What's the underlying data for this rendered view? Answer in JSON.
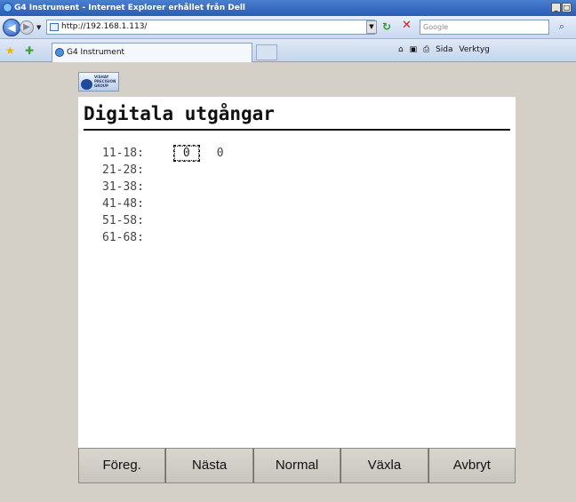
{
  "window": {
    "title": "G4 Instrument - Internet Explorer erhållet från Dell",
    "controls": [
      "_",
      "□",
      "x"
    ]
  },
  "address_bar": {
    "url": "http://192.168.1.113/",
    "search_placeholder": "Google"
  },
  "tabs": [
    {
      "label": "G4 Instrument",
      "active": true
    }
  ],
  "command_bar": {
    "home": "⌂",
    "feeds": "▣",
    "print": "⎙",
    "page_label": "Sida",
    "tools_label": "Verktyg"
  },
  "page": {
    "logo_text": "VISHAY\nPRECISION\nGROUP",
    "title": "Digitala utgångar",
    "outputs": [
      {
        "label": "11-18:",
        "values": [
          "0",
          "0"
        ],
        "focused_index": 0
      },
      {
        "label": "21-28:",
        "values": []
      },
      {
        "label": "31-38:",
        "values": []
      },
      {
        "label": "41-48:",
        "values": []
      },
      {
        "label": "51-58:",
        "values": []
      },
      {
        "label": "61-68:",
        "values": []
      }
    ],
    "buttons": [
      "Föreg.",
      "Nästa",
      "Normal",
      "Växla",
      "Avbryt"
    ]
  }
}
